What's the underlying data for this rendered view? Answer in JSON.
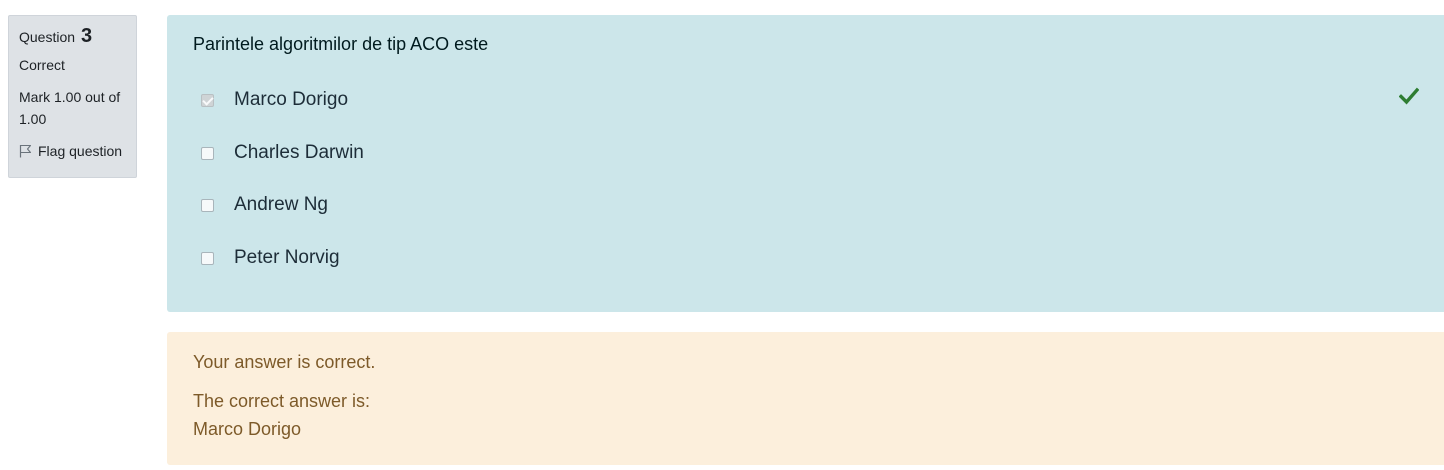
{
  "info": {
    "question_prefix": "Question",
    "question_number": "3",
    "state": "Correct",
    "grade": "Mark 1.00 out of 1.00",
    "flag_label": "Flag question",
    "flag_icon": "flag-icon"
  },
  "question": {
    "text": "Parintele algoritmilor de tip ACO este",
    "answers": [
      {
        "label": "Marco Dorigo",
        "checked": true
      },
      {
        "label": "Charles Darwin",
        "checked": false
      },
      {
        "label": "Andrew Ng",
        "checked": false
      },
      {
        "label": "Peter Norvig",
        "checked": false
      }
    ],
    "correct_icon": "checkmark-icon",
    "correct_icon_color": "#2e7d32"
  },
  "feedback": {
    "result": "Your answer is correct.",
    "correct_answer_prefix": "The correct answer is:",
    "correct_answer": "Marco Dorigo"
  },
  "colors": {
    "info_bg": "#dee2e6",
    "question_bg": "#cce6ea",
    "feedback_bg": "#fcefdc",
    "feedback_text": "#7d5a29"
  }
}
